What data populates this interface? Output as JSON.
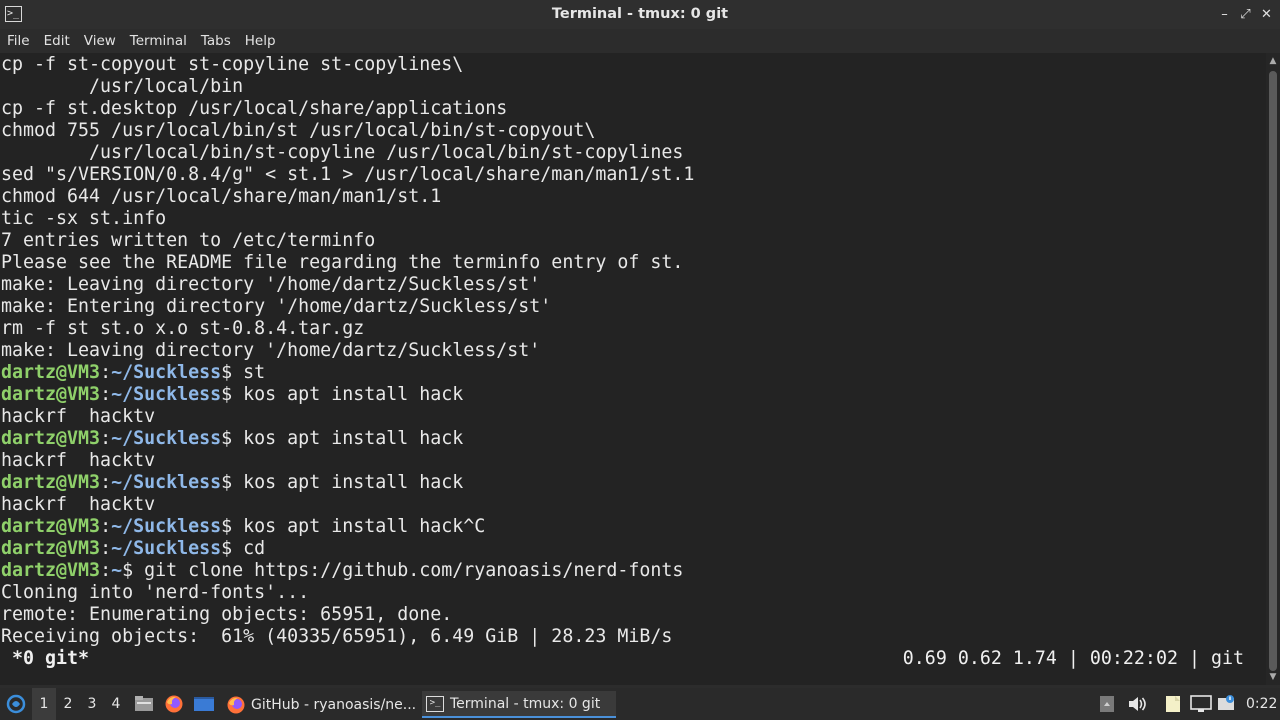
{
  "window": {
    "title": "Terminal - tmux: 0 git",
    "icon": "terminal-icon",
    "controls": [
      "minimize-icon",
      "maximize-icon",
      "close-icon"
    ]
  },
  "menu": [
    "File",
    "Edit",
    "View",
    "Terminal",
    "Tabs",
    "Help"
  ],
  "terminal": {
    "plain_lines": [
      "cp -f st-copyout st-copyline st-copylines\\",
      "        /usr/local/bin",
      "cp -f st.desktop /usr/local/share/applications",
      "chmod 755 /usr/local/bin/st /usr/local/bin/st-copyout\\",
      "        /usr/local/bin/st-copyline /usr/local/bin/st-copylines",
      "sed \"s/VERSION/0.8.4/g\" < st.1 > /usr/local/share/man/man1/st.1",
      "chmod 644 /usr/local/share/man/man1/st.1",
      "tic -sx st.info",
      "7 entries written to /etc/terminfo",
      "Please see the README file regarding the terminfo entry of st.",
      "make: Leaving directory '/home/dartz/Suckless/st'",
      "make: Entering directory '/home/dartz/Suckless/st'",
      "rm -f st st.o x.o st-0.8.4.tar.gz",
      "make: Leaving directory '/home/dartz/Suckless/st'"
    ],
    "prompt_user": "dartz@VM3",
    "prompt_sep": ":",
    "session": [
      {
        "path": "~/Suckless",
        "cmd": "$ st",
        "output": []
      },
      {
        "path": "~/Suckless",
        "cmd": "$ kos apt install hack",
        "output": [
          "hackrf  hacktv"
        ]
      },
      {
        "path": "~/Suckless",
        "cmd": "$ kos apt install hack",
        "output": [
          "hackrf  hacktv"
        ]
      },
      {
        "path": "~/Suckless",
        "cmd": "$ kos apt install hack",
        "output": [
          "hackrf  hacktv"
        ]
      },
      {
        "path": "~/Suckless",
        "cmd": "$ kos apt install hack^C",
        "output": []
      },
      {
        "path": "~/Suckless",
        "cmd": "$ cd",
        "output": []
      },
      {
        "path": "~",
        "cmd": "$ git clone https://github.com/ryanoasis/nerd-fonts",
        "output": [
          "Cloning into 'nerd-fonts'...",
          "remote: Enumerating objects: 65951, done.",
          "Receiving objects:  61% (40335/65951), 6.49 GiB | 28.23 MiB/s"
        ]
      }
    ]
  },
  "tmux": {
    "left": " *0 git*",
    "right": "0.69 0.62 1.74 | 00:22:02 | git"
  },
  "taskbar": {
    "menu_icon": "app-menu-icon",
    "workspaces": [
      "1",
      "2",
      "3",
      "4"
    ],
    "active_workspace": "1",
    "launchers": [
      "file-manager-icon",
      "firefox-icon",
      "desktop-icon"
    ],
    "tasks": [
      {
        "icon": "firefox-icon",
        "label": "GitHub - ryanoasis/ne..."
      },
      {
        "icon": "terminal-icon",
        "label": "Terminal - tmux: 0 git",
        "active": true
      }
    ],
    "tray": [
      "tray-box-icon",
      "volume-icon",
      "notes-icon",
      "display-icon",
      "network-icon"
    ],
    "clock": "0:22"
  },
  "colors": {
    "prompt_user": "#8fd06a",
    "prompt_path": "#8fb8e8",
    "terminal_bg": "#232323",
    "accent": "#4a90d9"
  }
}
